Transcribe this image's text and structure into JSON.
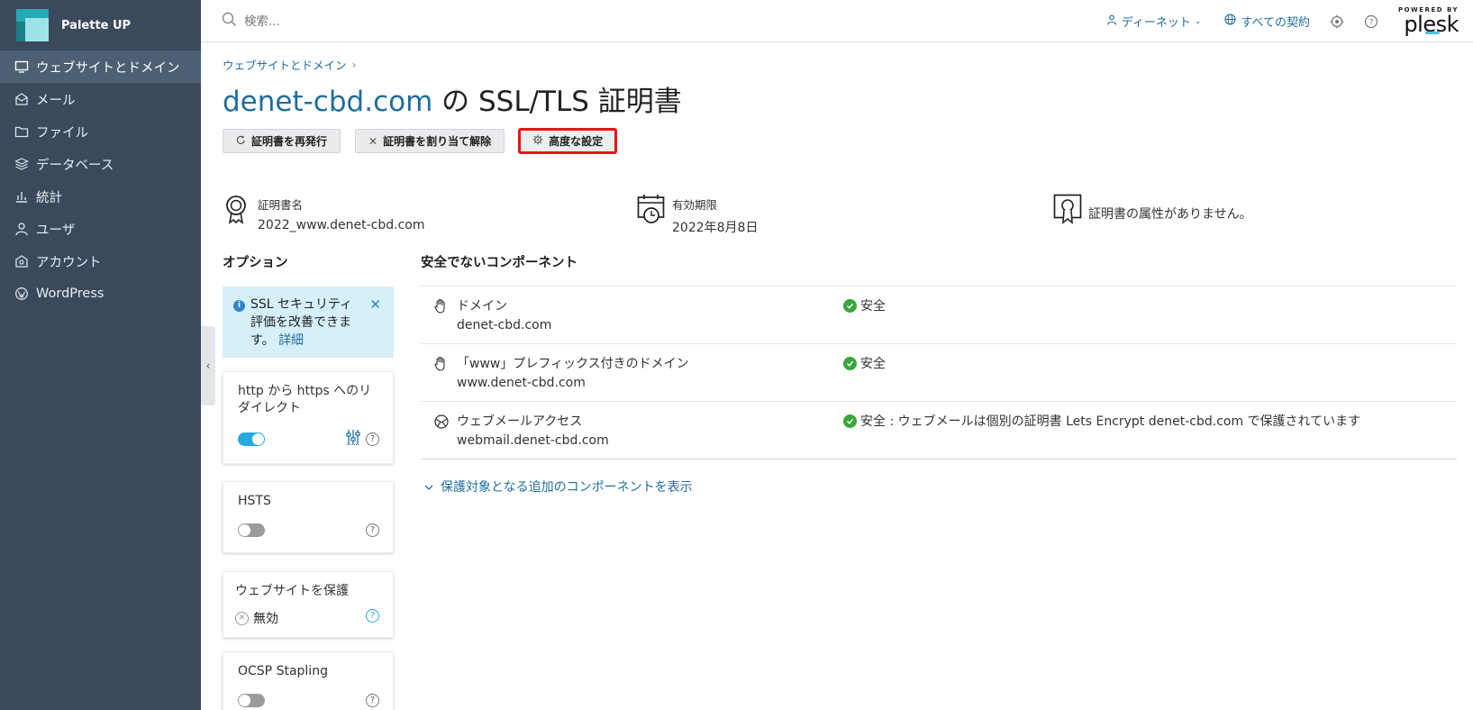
{
  "brand": {
    "name": "Palette UP"
  },
  "sidebar": {
    "items": [
      {
        "label": "ウェブサイトとドメイン",
        "icon": "monitor-icon",
        "active": true
      },
      {
        "label": "メール",
        "icon": "mail-icon"
      },
      {
        "label": "ファイル",
        "icon": "folder-icon"
      },
      {
        "label": "データベース",
        "icon": "database-icon"
      },
      {
        "label": "統計",
        "icon": "bar-chart-icon"
      },
      {
        "label": "ユーザ",
        "icon": "user-icon"
      },
      {
        "label": "アカウント",
        "icon": "account-icon"
      },
      {
        "label": "WordPress",
        "icon": "wordpress-icon"
      }
    ]
  },
  "topbar": {
    "search_placeholder": "検索...",
    "user_label": "ディーネット",
    "subscriptions_label": "すべての契約",
    "powered_by": "POWERED BY",
    "plesk": "plesk"
  },
  "breadcrumb": {
    "item": "ウェブサイトとドメイン"
  },
  "title": {
    "domain": "denet-cbd.com",
    "suffix": " の SSL/TLS 証明書"
  },
  "actions": {
    "reissue": "証明書を再発行",
    "unassign": "証明書を割り当て解除",
    "advanced": "高度な設定"
  },
  "summary": {
    "cert_name_label": "証明書名",
    "cert_name_value": "2022_www.denet-cbd.com",
    "expiry_label": "有効期限",
    "expiry_value": "2022年8月8日",
    "no_attributes": "証明書の属性がありません。"
  },
  "options": {
    "title": "オプション",
    "notice": {
      "text": "SSL セキュリティ評価を改善できます。",
      "link": "詳細"
    },
    "redirect": {
      "title": "http から https へのリダイレクト",
      "enabled": true
    },
    "hsts": {
      "title": "HSTS",
      "enabled": false
    },
    "protect": {
      "title": "ウェブサイトを保護",
      "status": "無効"
    },
    "ocsp": {
      "title": "OCSP Stapling",
      "enabled": false
    }
  },
  "components": {
    "title": "安全でないコンポーネント",
    "rows": [
      {
        "name": "ドメイン",
        "sub": "denet-cbd.com",
        "status": "安全"
      },
      {
        "name": "「www」プレフィックス付きのドメイン",
        "sub": "www.denet-cbd.com",
        "status": "安全"
      },
      {
        "name": "ウェブメールアクセス",
        "sub": "webmail.denet-cbd.com",
        "status": "安全 : ウェブメールは個別の証明書 Lets Encrypt denet-cbd.com で保護されています"
      }
    ],
    "more_link": "保護対象となる追加のコンポーネントを表示"
  },
  "colors": {
    "sidebar_bg": "#3a4a5c",
    "link": "#1f6e9e",
    "toggle_on": "#28a9e0",
    "ok": "#3aa63a",
    "highlight": "#ee1111"
  }
}
